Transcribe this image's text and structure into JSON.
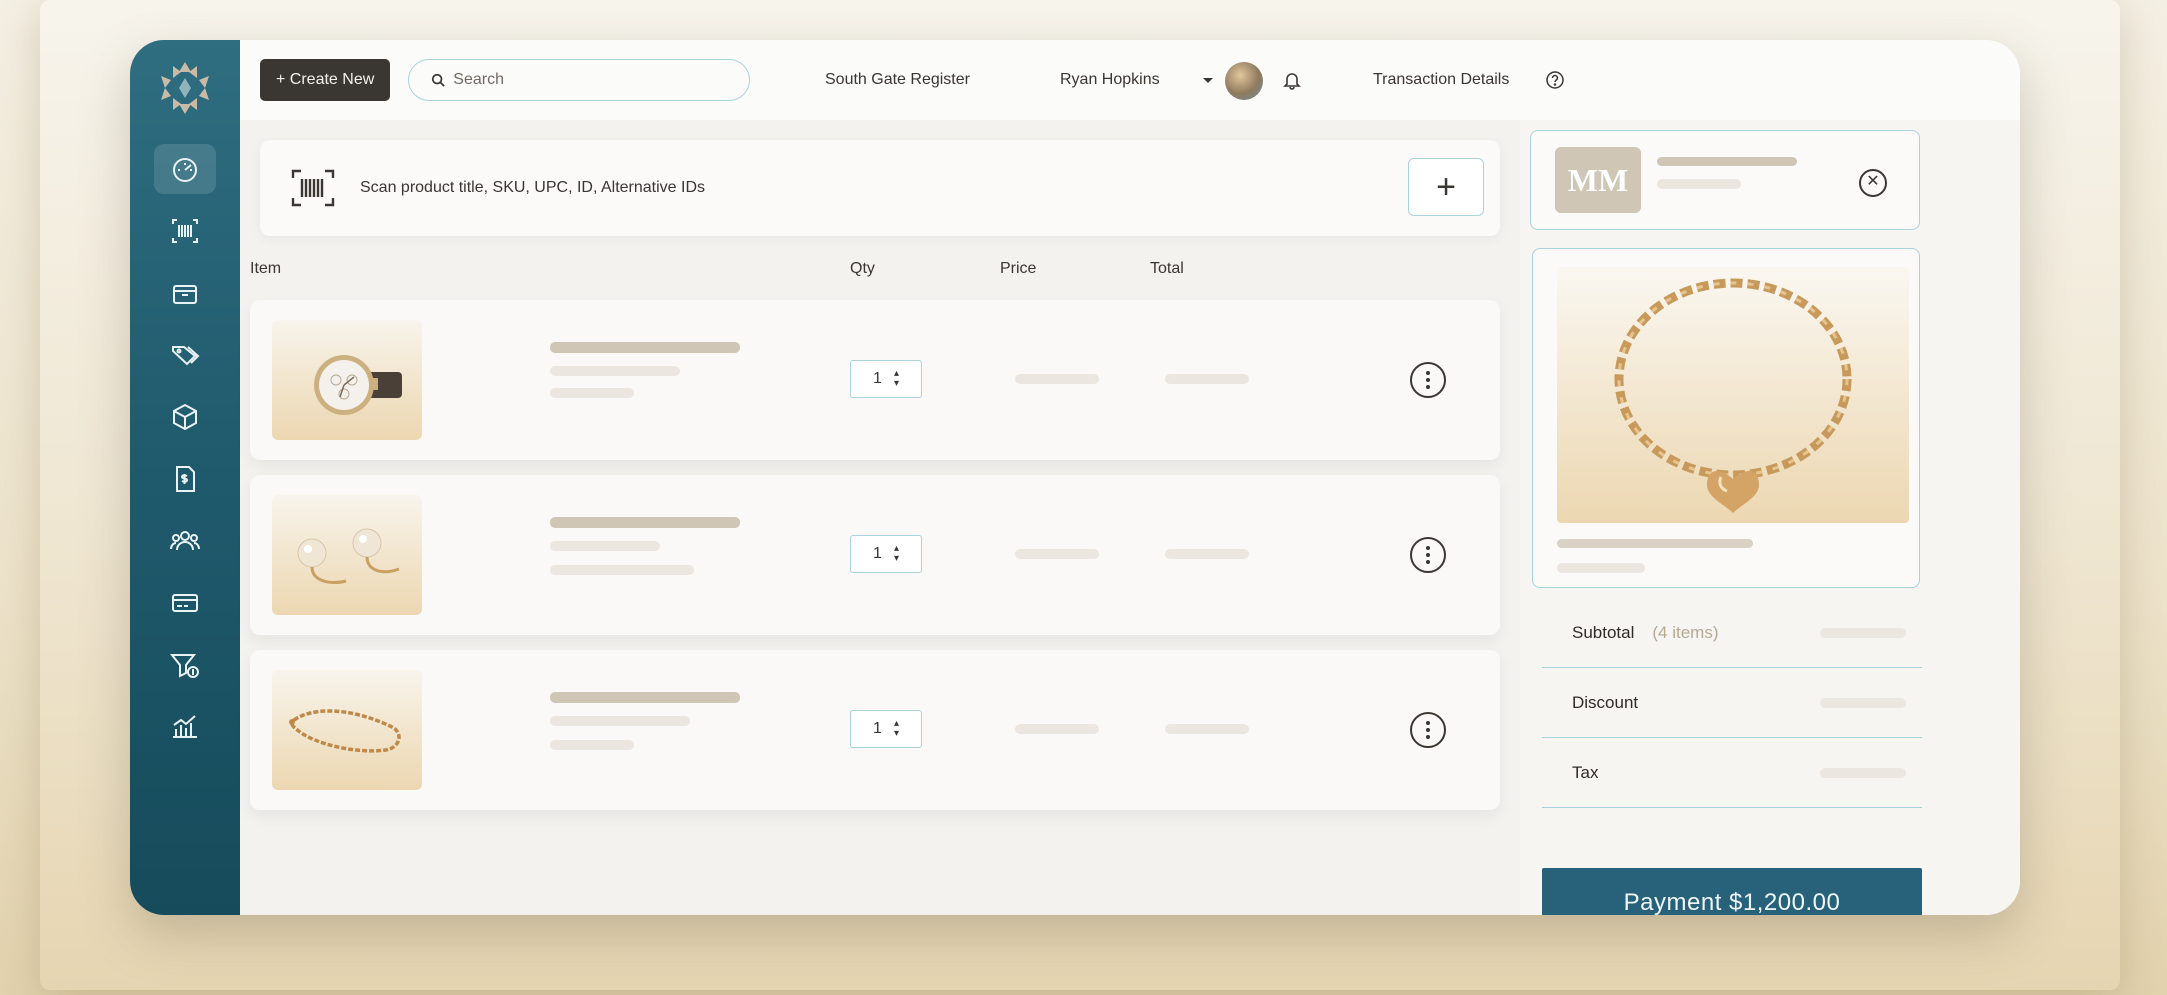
{
  "topbar": {
    "create_label": "+ Create New",
    "search_placeholder": "Search",
    "register": "South Gate Register",
    "user_name": "Ryan Hopkins",
    "details_label": "Transaction Details"
  },
  "sidebar": {
    "items": [
      {
        "icon": "dashboard-icon",
        "active": true
      },
      {
        "icon": "barcode-scan-icon"
      },
      {
        "icon": "box-icon"
      },
      {
        "icon": "tags-icon"
      },
      {
        "icon": "cube-icon"
      },
      {
        "icon": "invoice-icon"
      },
      {
        "icon": "customers-icon"
      },
      {
        "icon": "card-icon"
      },
      {
        "icon": "filter-money-icon"
      },
      {
        "icon": "analytics-icon"
      }
    ]
  },
  "scan": {
    "placeholder": "Scan product title, SKU, UPC, ID, Alternative IDs",
    "add_label": "+"
  },
  "columns": {
    "item": "Item",
    "qty": "Qty",
    "price": "Price",
    "total": "Total"
  },
  "items": [
    {
      "product": "watch",
      "qty": "1"
    },
    {
      "product": "pearl earrings",
      "qty": "1"
    },
    {
      "product": "bracelet",
      "qty": "1"
    }
  ],
  "customer": {
    "initials": "MM"
  },
  "summary": {
    "subtotal_label": "Subtotal",
    "subtotal_count": "(4 items)",
    "discount_label": "Discount",
    "tax_label": "Tax"
  },
  "payment_label": "Payment $1,200.00",
  "colors": {
    "sidebar": "#1f5a6c",
    "accent_border": "#a9d4dc",
    "payment": "#27627a",
    "create": "#3a3632"
  }
}
